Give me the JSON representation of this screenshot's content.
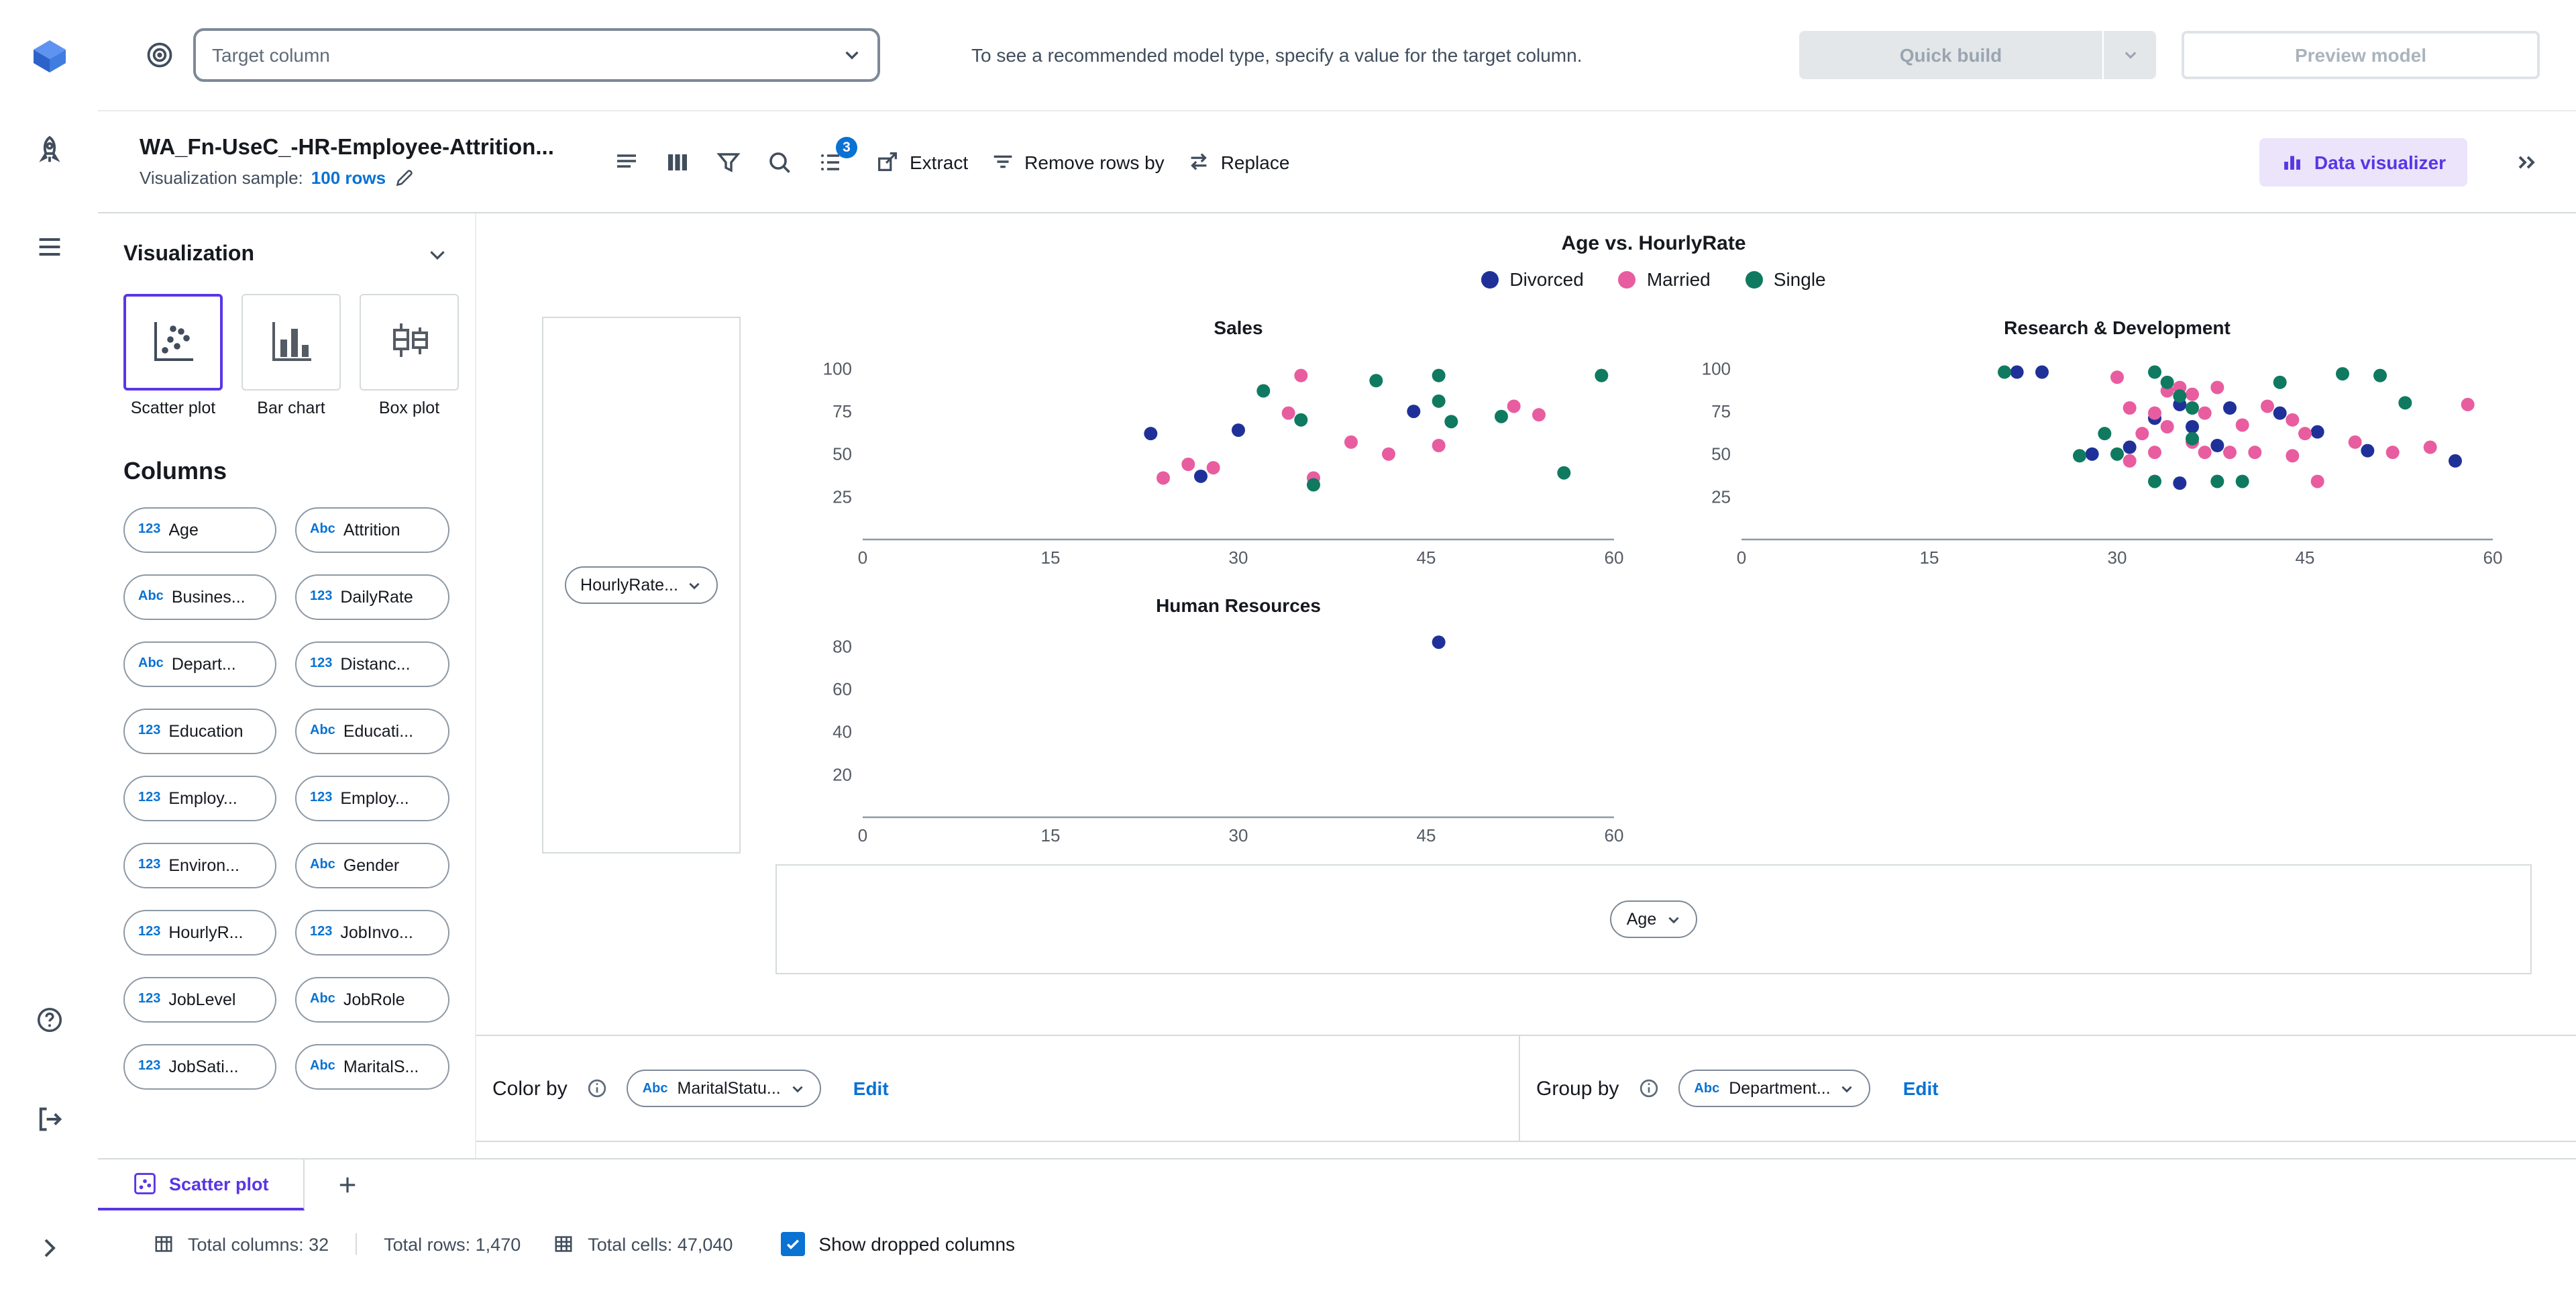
{
  "topbar": {
    "target_select": {
      "placeholder": "Target column"
    },
    "hint": "To see a recommended model type, specify a value for the target column.",
    "quick_build": "Quick build",
    "preview_model": "Preview model"
  },
  "dataset": {
    "name": "WA_Fn-UseC_-HR-Employee-Attrition...",
    "sample_label": "Visualization sample:",
    "sample_value": "100 rows"
  },
  "toolbar": {
    "badge_count": "3",
    "extract": "Extract",
    "remove_rows": "Remove rows by",
    "replace": "Replace",
    "data_visualizer": "Data visualizer"
  },
  "panel": {
    "title": "Visualization",
    "chart_types": [
      {
        "label": "Scatter plot",
        "selected": true
      },
      {
        "label": "Bar chart",
        "selected": false
      },
      {
        "label": "Box plot",
        "selected": false
      }
    ],
    "columns_title": "Columns",
    "columns": [
      {
        "type": "123",
        "label": "Age"
      },
      {
        "type": "Abc",
        "label": "Attrition"
      },
      {
        "type": "Abc",
        "label": "Busines..."
      },
      {
        "type": "123",
        "label": "DailyRate"
      },
      {
        "type": "Abc",
        "label": "Depart..."
      },
      {
        "type": "123",
        "label": "Distanc..."
      },
      {
        "type": "123",
        "label": "Education"
      },
      {
        "type": "Abc",
        "label": "Educati..."
      },
      {
        "type": "123",
        "label": "Employ..."
      },
      {
        "type": "123",
        "label": "Employ..."
      },
      {
        "type": "123",
        "label": "Environ..."
      },
      {
        "type": "Abc",
        "label": "Gender"
      },
      {
        "type": "123",
        "label": "HourlyR..."
      },
      {
        "type": "123",
        "label": "JobInvo..."
      },
      {
        "type": "123",
        "label": "JobLevel"
      },
      {
        "type": "Abc",
        "label": "JobRole"
      },
      {
        "type": "123",
        "label": "JobSati..."
      },
      {
        "type": "Abc",
        "label": "MaritalS..."
      }
    ]
  },
  "chart_data": {
    "type": "scatter",
    "title": "Age vs. HourlyRate",
    "xlabel": "Age",
    "ylabel": "HourlyRate",
    "x_axis_field": "Age",
    "y_axis_field": "HourlyRate...",
    "x_ticks": [
      0,
      15,
      30,
      45,
      60
    ],
    "x_max": 60,
    "legend": [
      {
        "label": "Divorced",
        "color": "#1f3199"
      },
      {
        "label": "Married",
        "color": "#e85d9f"
      },
      {
        "label": "Single",
        "color": "#0f7a60"
      }
    ],
    "panels": [
      {
        "title": "Sales",
        "y_ticks": [
          100,
          75,
          50,
          25
        ],
        "y_max": 110,
        "points": [
          [
            23,
            62,
            "Divorced"
          ],
          [
            30,
            64,
            "Divorced"
          ],
          [
            27,
            37,
            "Divorced"
          ],
          [
            44,
            75,
            "Divorced"
          ],
          [
            24,
            36,
            "Married"
          ],
          [
            26,
            44,
            "Married"
          ],
          [
            28,
            42,
            "Married"
          ],
          [
            34,
            74,
            "Married"
          ],
          [
            35,
            96,
            "Married"
          ],
          [
            36,
            36,
            "Married"
          ],
          [
            39,
            57,
            "Married"
          ],
          [
            42,
            50,
            "Married"
          ],
          [
            46,
            55,
            "Married"
          ],
          [
            52,
            78,
            "Married"
          ],
          [
            54,
            73,
            "Married"
          ],
          [
            32,
            87,
            "Single"
          ],
          [
            35,
            70,
            "Single"
          ],
          [
            36,
            32,
            "Single"
          ],
          [
            41,
            93,
            "Single"
          ],
          [
            46,
            96,
            "Single"
          ],
          [
            46,
            81,
            "Single"
          ],
          [
            47,
            69,
            "Single"
          ],
          [
            51,
            72,
            "Single"
          ],
          [
            56,
            39,
            "Single"
          ],
          [
            59,
            96,
            "Single"
          ]
        ]
      },
      {
        "title": "Research & Development",
        "y_ticks": [
          100,
          75,
          50,
          25
        ],
        "y_max": 110,
        "points": [
          [
            22,
            98,
            "Divorced"
          ],
          [
            24,
            98,
            "Divorced"
          ],
          [
            31,
            54,
            "Divorced"
          ],
          [
            33,
            71,
            "Divorced"
          ],
          [
            35,
            79,
            "Divorced"
          ],
          [
            36,
            66,
            "Divorced"
          ],
          [
            38,
            55,
            "Divorced"
          ],
          [
            39,
            77,
            "Divorced"
          ],
          [
            43,
            74,
            "Divorced"
          ],
          [
            50,
            52,
            "Divorced"
          ],
          [
            57,
            46,
            "Divorced"
          ],
          [
            28,
            50,
            "Divorced"
          ],
          [
            35,
            33,
            "Divorced"
          ],
          [
            46,
            63,
            "Divorced"
          ],
          [
            30,
            95,
            "Married"
          ],
          [
            31,
            77,
            "Married"
          ],
          [
            32,
            62,
            "Married"
          ],
          [
            33,
            74,
            "Married"
          ],
          [
            34,
            87,
            "Married"
          ],
          [
            35,
            89,
            "Married"
          ],
          [
            36,
            85,
            "Married"
          ],
          [
            37,
            51,
            "Married"
          ],
          [
            38,
            89,
            "Married"
          ],
          [
            39,
            51,
            "Married"
          ],
          [
            40,
            67,
            "Married"
          ],
          [
            41,
            51,
            "Married"
          ],
          [
            42,
            78,
            "Married"
          ],
          [
            44,
            70,
            "Married"
          ],
          [
            45,
            62,
            "Married"
          ],
          [
            46,
            34,
            "Married"
          ],
          [
            49,
            57,
            "Married"
          ],
          [
            52,
            51,
            "Married"
          ],
          [
            55,
            54,
            "Married"
          ],
          [
            58,
            79,
            "Married"
          ],
          [
            33,
            51,
            "Married"
          ],
          [
            37,
            74,
            "Married"
          ],
          [
            31,
            46,
            "Married"
          ],
          [
            44,
            49,
            "Married"
          ],
          [
            36,
            57,
            "Married"
          ],
          [
            34,
            66,
            "Married"
          ],
          [
            21,
            98,
            "Single"
          ],
          [
            29,
            62,
            "Single"
          ],
          [
            30,
            50,
            "Single"
          ],
          [
            33,
            98,
            "Single"
          ],
          [
            34,
            92,
            "Single"
          ],
          [
            35,
            84,
            "Single"
          ],
          [
            36,
            77,
            "Single"
          ],
          [
            38,
            34,
            "Single"
          ],
          [
            40,
            34,
            "Single"
          ],
          [
            48,
            97,
            "Single"
          ],
          [
            51,
            96,
            "Single"
          ],
          [
            27,
            49,
            "Single"
          ],
          [
            33,
            34,
            "Single"
          ],
          [
            36,
            59,
            "Single"
          ],
          [
            43,
            92,
            "Single"
          ],
          [
            53,
            80,
            "Single"
          ]
        ]
      },
      {
        "title": "Human Resources",
        "y_ticks": [
          80,
          60,
          40,
          20
        ],
        "y_max": 88,
        "points": [
          [
            46,
            82,
            "Divorced"
          ]
        ]
      }
    ]
  },
  "color_by": {
    "label": "Color by",
    "field_type": "Abc",
    "field": "MaritalStatu...",
    "edit": "Edit"
  },
  "group_by": {
    "label": "Group by",
    "field_type": "Abc",
    "field": "Department...",
    "edit": "Edit"
  },
  "tabs": {
    "active": "Scatter plot"
  },
  "status_bar": {
    "total_columns": "Total columns: 32",
    "total_rows": "Total rows: 1,470",
    "total_cells": "Total cells: 47,040",
    "show_dropped": "Show dropped columns"
  }
}
